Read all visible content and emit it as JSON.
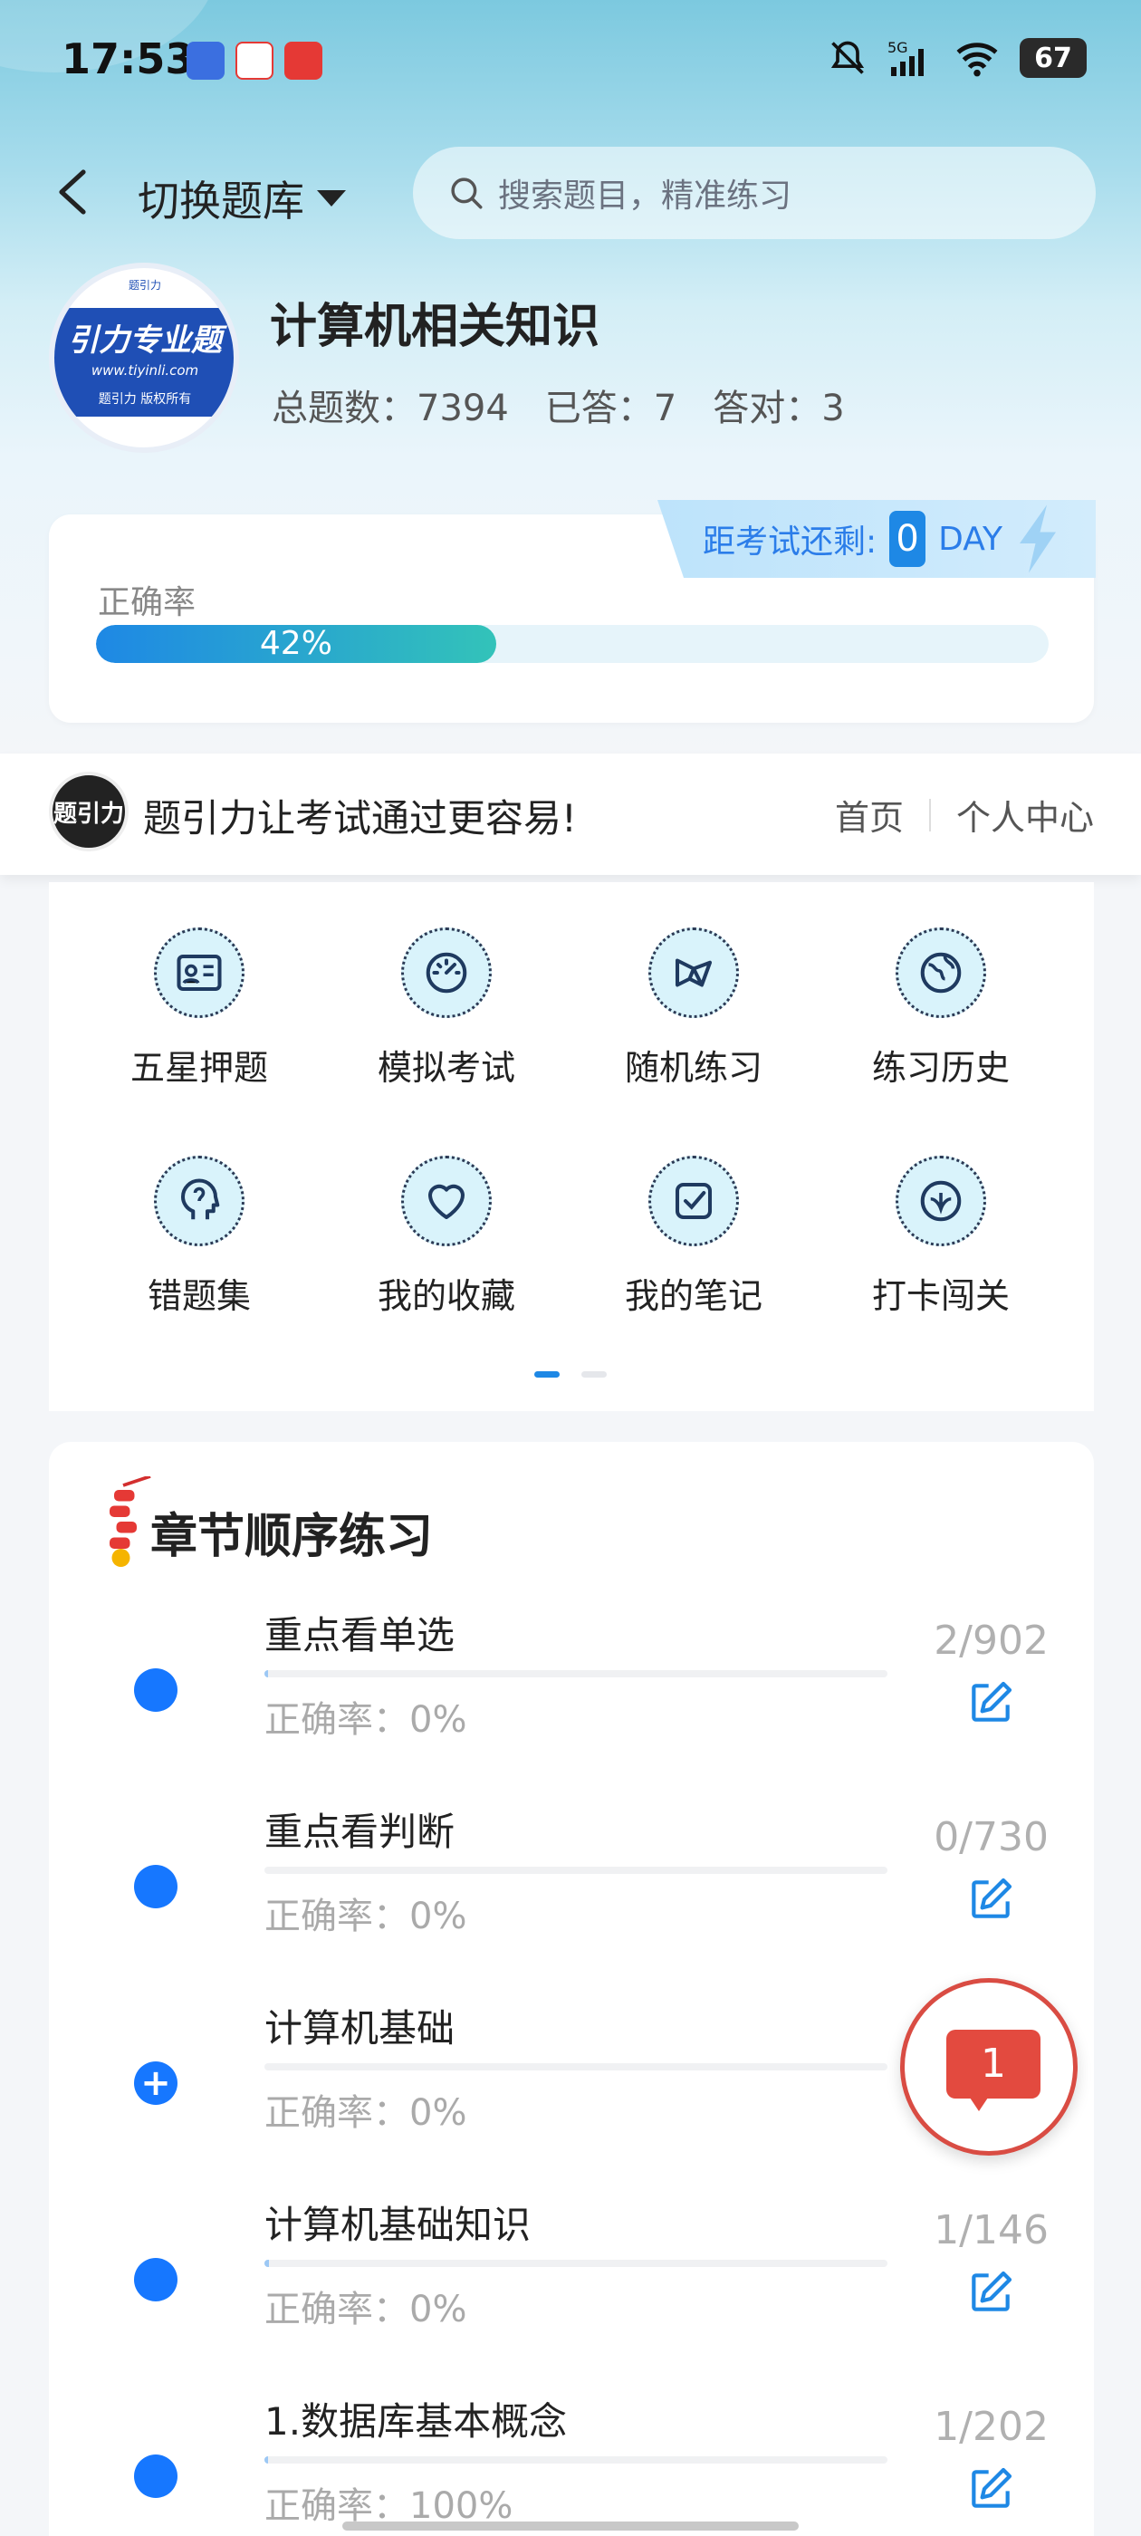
{
  "status_bar": {
    "time": "17:53",
    "network": "5G",
    "battery": "67"
  },
  "header": {
    "back_icon": "chevron-left-icon",
    "switch_label": "切换题库",
    "search_placeholder": "搜索题目，精准练习"
  },
  "bank": {
    "logo_text": "引力专业题",
    "logo_url": "www.tiyinli.com",
    "logo_copyright": "题引力 版权所有",
    "logo_top": "题引力",
    "name": "计算机相关知识",
    "total_label": "总题数：7394",
    "answered_label": "已答：7",
    "correct_label": "答对：3"
  },
  "accuracy": {
    "label": "正确率",
    "percent": 42,
    "percent_text": "42%"
  },
  "countdown": {
    "label": "距考试还剩:",
    "days": "0",
    "unit": "DAY"
  },
  "brand": {
    "logo_text": "题引力",
    "slogan": "题引力让考试通过更容易!",
    "nav": [
      "首页",
      "个人中心"
    ]
  },
  "functions": [
    {
      "label": "五星押题",
      "icon": "id-card-icon"
    },
    {
      "label": "模拟考试",
      "icon": "speedometer-icon"
    },
    {
      "label": "随机练习",
      "icon": "network-icon"
    },
    {
      "label": "练习历史",
      "icon": "globe-icon"
    },
    {
      "label": "错题集",
      "icon": "head-icon"
    },
    {
      "label": "我的收藏",
      "icon": "heart-icon"
    },
    {
      "label": "我的笔记",
      "icon": "checkbox-icon"
    },
    {
      "label": "打卡闯关",
      "icon": "shield-icon"
    }
  ],
  "chapters": {
    "title": "章节顺序练习",
    "items": [
      {
        "name": "重点看单选",
        "accuracy": "正确率：0%",
        "count": "2/902",
        "progress": 0.0022,
        "expandable": false
      },
      {
        "name": "重点看判断",
        "accuracy": "正确率：0%",
        "count": "0/730",
        "progress": 0,
        "expandable": false
      },
      {
        "name": "计算机基础",
        "accuracy": "正确率：0%",
        "count": "",
        "progress": 0,
        "expandable": true
      },
      {
        "name": "计算机基础知识",
        "accuracy": "正确率：0%",
        "count": "1/146",
        "progress": 0.0068,
        "expandable": false
      },
      {
        "name": "1.数据库基本概念",
        "accuracy": "正确率：100%",
        "count": "1/202",
        "progress": 0.005,
        "expandable": false
      }
    ]
  },
  "fab": {
    "badge": "1"
  },
  "colors": {
    "accent": "#1677ff",
    "fab": "#e34a3f"
  }
}
